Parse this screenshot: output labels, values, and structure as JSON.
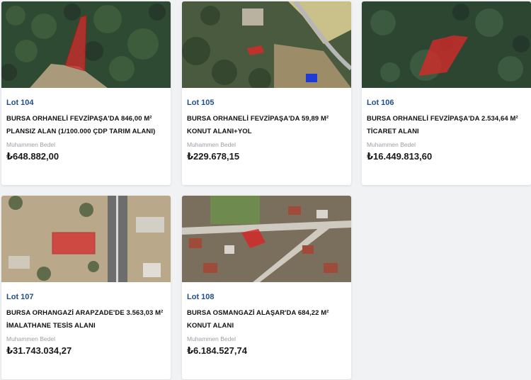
{
  "lots": [
    {
      "lot": "Lot 104",
      "title_line1": "BURSA ORHANELİ FEVZİPAŞA'DA 846,00 M²",
      "title_line2": "PLANSIZ ALAN (1/100.000 ÇDP TARIM ALANI)",
      "price_label": "Muhammen Bedel",
      "price": "₺648.882,00"
    },
    {
      "lot": "Lot 105",
      "title_line1": "BURSA ORHANELİ FEVZİPAŞA'DA 59,89 M²",
      "title_line2": "KONUT ALANI+YOL",
      "price_label": "Muhammen Bedel",
      "price": "₺229.678,15"
    },
    {
      "lot": "Lot 106",
      "title_line1": "BURSA ORHANELİ FEVZİPAŞA'DA 2.534,64 M²",
      "title_line2": "TİCARET ALANI",
      "price_label": "Muhammen Bedel",
      "price": "₺16.449.813,60"
    },
    {
      "lot": "Lot 107",
      "title_line1": "BURSA ORHANGAZİ ARAPZADE'DE 3.563,03 M²",
      "title_line2": "İMALATHANE TESİS ALANI",
      "price_label": "Muhammen Bedel",
      "price": "₺31.743.034,27"
    },
    {
      "lot": "Lot 108",
      "title_line1": "BURSA OSMANGAZİ ALAŞAR'DA 684,22 M²",
      "title_line2": "KONUT ALANI",
      "price_label": "Muhammen Bedel",
      "price": "₺6.184.527,74"
    }
  ],
  "colors": {
    "lot_label": "#1f4e8c",
    "parcel_highlight": "#d42a2a"
  }
}
